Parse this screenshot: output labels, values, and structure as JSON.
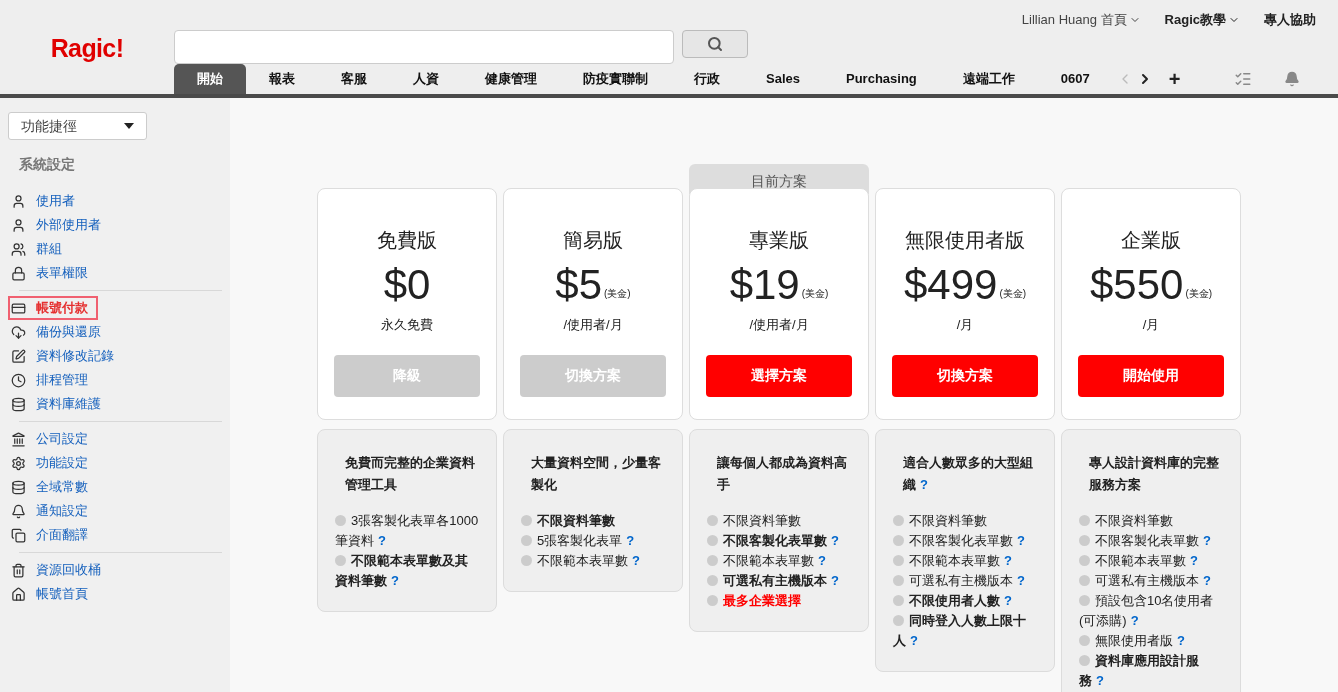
{
  "logo": "Ragic!",
  "top_links": [
    {
      "label": "Lillian Huang 首頁",
      "kind": "user",
      "dropdown": true
    },
    {
      "label": "Ragic教學",
      "kind": "menu",
      "dropdown": true
    },
    {
      "label": "專人協助",
      "kind": "menu",
      "dropdown": false
    }
  ],
  "tabs": [
    {
      "label": "開始",
      "selected": true
    },
    {
      "label": "報表",
      "selected": false
    },
    {
      "label": "客服",
      "selected": false
    },
    {
      "label": "人資",
      "selected": false
    },
    {
      "label": "健康管理",
      "selected": false
    },
    {
      "label": "防疫實聯制",
      "selected": false
    },
    {
      "label": "行政",
      "selected": false
    },
    {
      "label": "Sales",
      "selected": false
    },
    {
      "label": "Purchasing",
      "selected": false
    },
    {
      "label": "遠端工作",
      "selected": false
    },
    {
      "label": "0607",
      "selected": false
    }
  ],
  "tab_add": "+",
  "shortcut_dropdown": {
    "label": "功能捷徑"
  },
  "sidebar": {
    "title": "系統設定",
    "groups": [
      [
        {
          "label": "使用者",
          "selected": false
        },
        {
          "label": "外部使用者",
          "selected": false
        },
        {
          "label": "群組",
          "selected": false
        },
        {
          "label": "表單權限",
          "selected": false
        }
      ],
      [
        {
          "label": "帳號付款",
          "selected": true
        },
        {
          "label": "備份與還原",
          "selected": false
        },
        {
          "label": "資料修改記錄",
          "selected": false
        },
        {
          "label": "排程管理",
          "selected": false
        },
        {
          "label": "資料庫維護",
          "selected": false
        }
      ],
      [
        {
          "label": "公司設定",
          "selected": false
        },
        {
          "label": "功能設定",
          "selected": false
        },
        {
          "label": "全域常數",
          "selected": false
        },
        {
          "label": "通知設定",
          "selected": false
        },
        {
          "label": "介面翻譯",
          "selected": false
        }
      ],
      [
        {
          "label": "資源回收桶",
          "selected": false
        },
        {
          "label": "帳號首頁",
          "selected": false
        }
      ]
    ]
  },
  "plans": [
    {
      "name": "免費版",
      "current": false,
      "price": "$0",
      "period": "永久免費",
      "button": "降級",
      "disabled": true,
      "summary": "免費而完整的企業資料管理工具",
      "summary_help": false,
      "features": [
        {
          "text": "3張客製化表單各1000筆資料",
          "kind": "normal",
          "help": true
        },
        {
          "text": "不限範本表單數及其資料筆數",
          "kind": "bold",
          "help": true
        }
      ]
    },
    {
      "name": "簡易版",
      "current": false,
      "price": "$5",
      "currency": "(美金)",
      "period": "/使用者/月",
      "button": "切換方案",
      "disabled": true,
      "summary": "大量資料空間，少量客製化",
      "summary_help": false,
      "features": [
        {
          "text": "不限資料筆數",
          "kind": "bold",
          "help": false
        },
        {
          "text": "5張客製化表單",
          "kind": "normal",
          "help": true
        },
        {
          "text": "不限範本表單數",
          "kind": "normal",
          "help": true
        }
      ]
    },
    {
      "name": "專業版",
      "current": true,
      "current_label": "目前方案",
      "price": "$19",
      "currency": "(美金)",
      "period": "/使用者/月",
      "button": "選擇方案",
      "disabled": false,
      "summary": "讓每個人都成為資料高手",
      "summary_help": false,
      "features": [
        {
          "text": "不限資料筆數",
          "kind": "normal",
          "help": false
        },
        {
          "text": "不限客製化表單數",
          "kind": "bold",
          "help": true
        },
        {
          "text": "不限範本表單數",
          "kind": "normal",
          "help": true
        },
        {
          "text": "可選私有主機版本",
          "kind": "bold",
          "help": true
        },
        {
          "text": "最多企業選擇",
          "kind": "highlight",
          "help": false
        }
      ]
    },
    {
      "name": "無限使用者版",
      "current": false,
      "price": "$499",
      "currency": "(美金)",
      "period": "/月",
      "button": "切換方案",
      "disabled": false,
      "summary": "適合人數眾多的大型組織",
      "summary_help": true,
      "features": [
        {
          "text": "不限資料筆數",
          "kind": "normal",
          "help": false
        },
        {
          "text": "不限客製化表單數",
          "kind": "normal",
          "help": true
        },
        {
          "text": "不限範本表單數",
          "kind": "normal",
          "help": true
        },
        {
          "text": "可選私有主機版本",
          "kind": "normal",
          "help": true
        },
        {
          "text": "不限使用者人數",
          "kind": "bold",
          "help": true
        },
        {
          "text": "同時登入人數上限十人",
          "kind": "bold",
          "help": true
        }
      ]
    },
    {
      "name": "企業版",
      "current": false,
      "price": "$550",
      "currency": "(美金)",
      "period": "/月",
      "button": "開始使用",
      "disabled": false,
      "summary": "專人設計資料庫的完整服務方案",
      "summary_help": false,
      "features": [
        {
          "text": "不限資料筆數",
          "kind": "normal",
          "help": false
        },
        {
          "text": "不限客製化表單數",
          "kind": "normal",
          "help": true
        },
        {
          "text": "不限範本表單數",
          "kind": "normal",
          "help": true
        },
        {
          "text": "可選私有主機版本",
          "kind": "normal",
          "help": true
        },
        {
          "text": "預設包含10名使用者(可添購)",
          "kind": "normal",
          "help": true
        },
        {
          "text": "無限使用者版",
          "kind": "normal",
          "help": true
        },
        {
          "text": "資料庫應用設計服務",
          "kind": "bold",
          "help": true
        }
      ]
    }
  ],
  "help_mark": "?"
}
